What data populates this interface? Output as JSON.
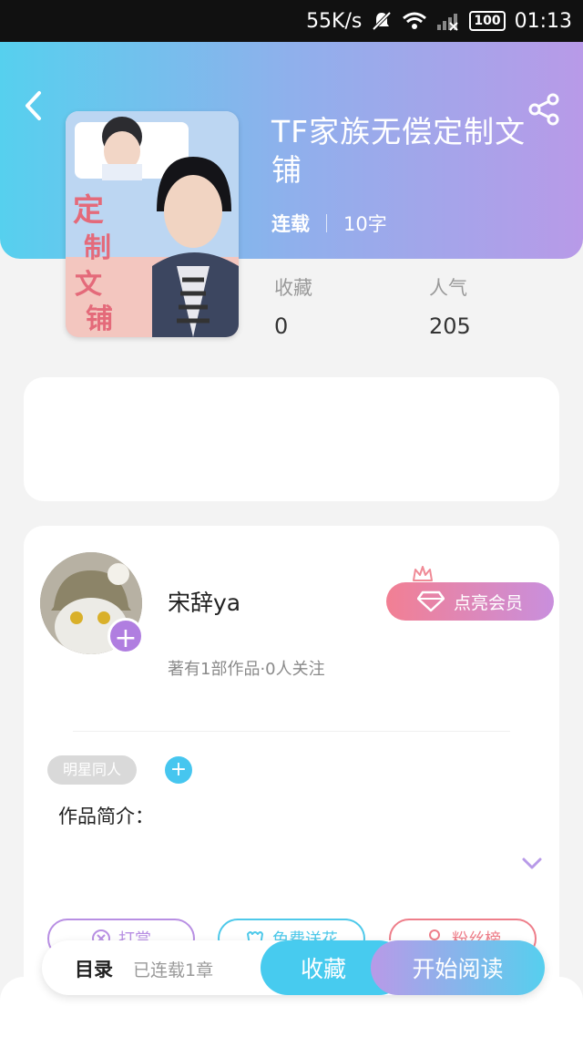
{
  "status_bar": {
    "speed": "55K/s",
    "battery": "100",
    "time": "01:13"
  },
  "book": {
    "title": "TF家族无偿定制文铺",
    "status": "连载",
    "word_count": "10字",
    "stats": [
      {
        "label": "收藏",
        "value": "0"
      },
      {
        "label": "人气",
        "value": "205"
      }
    ]
  },
  "author": {
    "name": "宋辞ya",
    "summary": "著有1部作品·0人关注",
    "vip_label": "点亮会员"
  },
  "work": {
    "tag": "明星同人",
    "intro_label": "作品简介："
  },
  "actions": [
    {
      "label": "打赏",
      "icon": "coin-icon"
    },
    {
      "label": "免费送花",
      "icon": "flower-icon"
    },
    {
      "label": "粉丝榜",
      "icon": "person-icon"
    }
  ],
  "bottom_bar": {
    "catalog_label": "目录",
    "catalog_sub": "已连载1章",
    "collect_label": "收藏",
    "read_label": "开始阅读"
  },
  "colors": {
    "accent_blue": "#47cbef",
    "accent_purple": "#b89ae8",
    "accent_pink": "#ee7e8a"
  }
}
